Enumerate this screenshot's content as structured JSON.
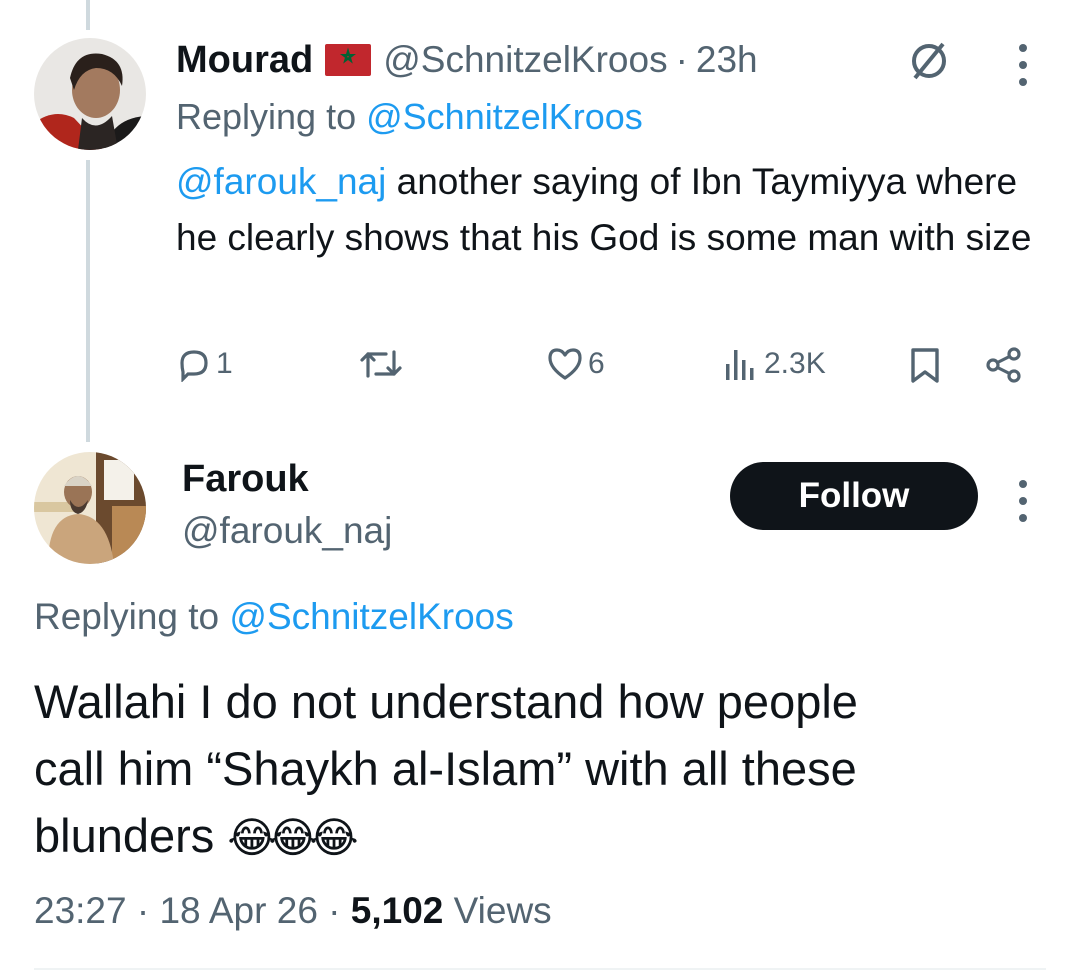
{
  "reply_tweet": {
    "author_name": "Mourad",
    "author_flag": "🇲🇦",
    "author_handle": "@SchnitzelKroos",
    "separator": "·",
    "time_ago": "23h",
    "replying_prefix": "Replying to",
    "replying_handle": "@SchnitzelKroos",
    "text_mention": "@farouk_naj",
    "text_body": "another saying of Ibn Taymiyya where he clearly shows that his God is some man with size",
    "actions": {
      "replies": "1",
      "retweets": "",
      "likes": "6",
      "views": "2.3K"
    }
  },
  "main_tweet": {
    "author_name": "Farouk",
    "author_handle": "@farouk_naj",
    "follow_label": "Follow",
    "replying_prefix": "Replying to",
    "replying_handle": "@SchnitzelKroos",
    "text_line1": "Wallahi I do not understand how people",
    "text_line2": "call him “Shaykh al-Islam” with all these",
    "text_line3": "blunders",
    "emoji": "😂😂😂",
    "time": "23:27",
    "separator": "·",
    "date": "18 Apr 26",
    "views_count": "5,102",
    "views_label": "Views"
  },
  "colors": {
    "text": "#0f1419",
    "muted": "#536471",
    "link": "#1d9bf0",
    "thread_line": "#cfd9de",
    "button_bg": "#0f1419"
  },
  "icons": [
    "no-sign-icon",
    "more-icon",
    "reply-icon",
    "retweet-icon",
    "like-icon",
    "views-icon",
    "bookmark-icon",
    "share-icon"
  ]
}
